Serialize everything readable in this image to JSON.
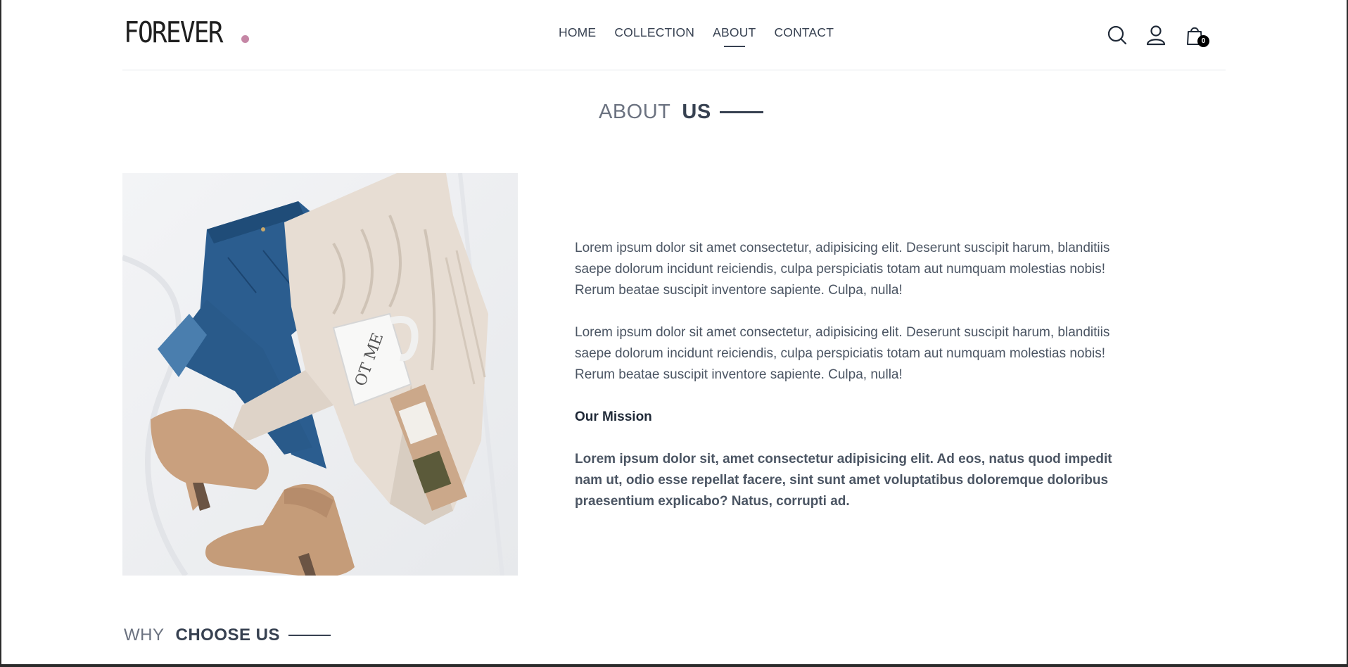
{
  "brand": {
    "logo_text": "FOREVER",
    "accent_dot_color": "#c586a5"
  },
  "nav": {
    "links": [
      {
        "label": "HOME"
      },
      {
        "label": "COLLECTION"
      },
      {
        "label": "ABOUT",
        "active": true
      },
      {
        "label": "CONTACT"
      }
    ],
    "icons": [
      "search-icon",
      "profile-icon",
      "cart-icon"
    ],
    "cart_count": "0"
  },
  "about": {
    "title_light": "ABOUT",
    "title_dark": "US",
    "image_alt": "Flat lay of jeans, sweater, mug, tea bag and boots",
    "paragraph_1": "Lorem ipsum dolor sit amet consectetur, adipisicing elit. Deserunt suscipit harum, blanditiis saepe dolorum incidunt reiciendis, culpa perspiciatis totam aut numquam molestias nobis! Rerum beatae suscipit inventore sapiente. Culpa, nulla!",
    "paragraph_2": "Lorem ipsum dolor sit amet consectetur, adipisicing elit. Deserunt suscipit harum, blanditiis saepe dolorum incidunt reiciendis, culpa perspiciatis totam aut numquam molestias nobis! Rerum beatae suscipit inventore sapiente. Culpa, nulla!",
    "mission_heading": "Our Mission",
    "mission_text": "Lorem ipsum dolor sit, amet consectetur adipisicing elit. Ad eos, natus quod impedit nam ut, odio esse repellat facere, sint sunt amet voluptatibus doloremque doloribus praesentium explicabo? Natus, corrupti ad."
  },
  "why": {
    "title_light": "WHY",
    "title_dark": "CHOOSE US"
  }
}
